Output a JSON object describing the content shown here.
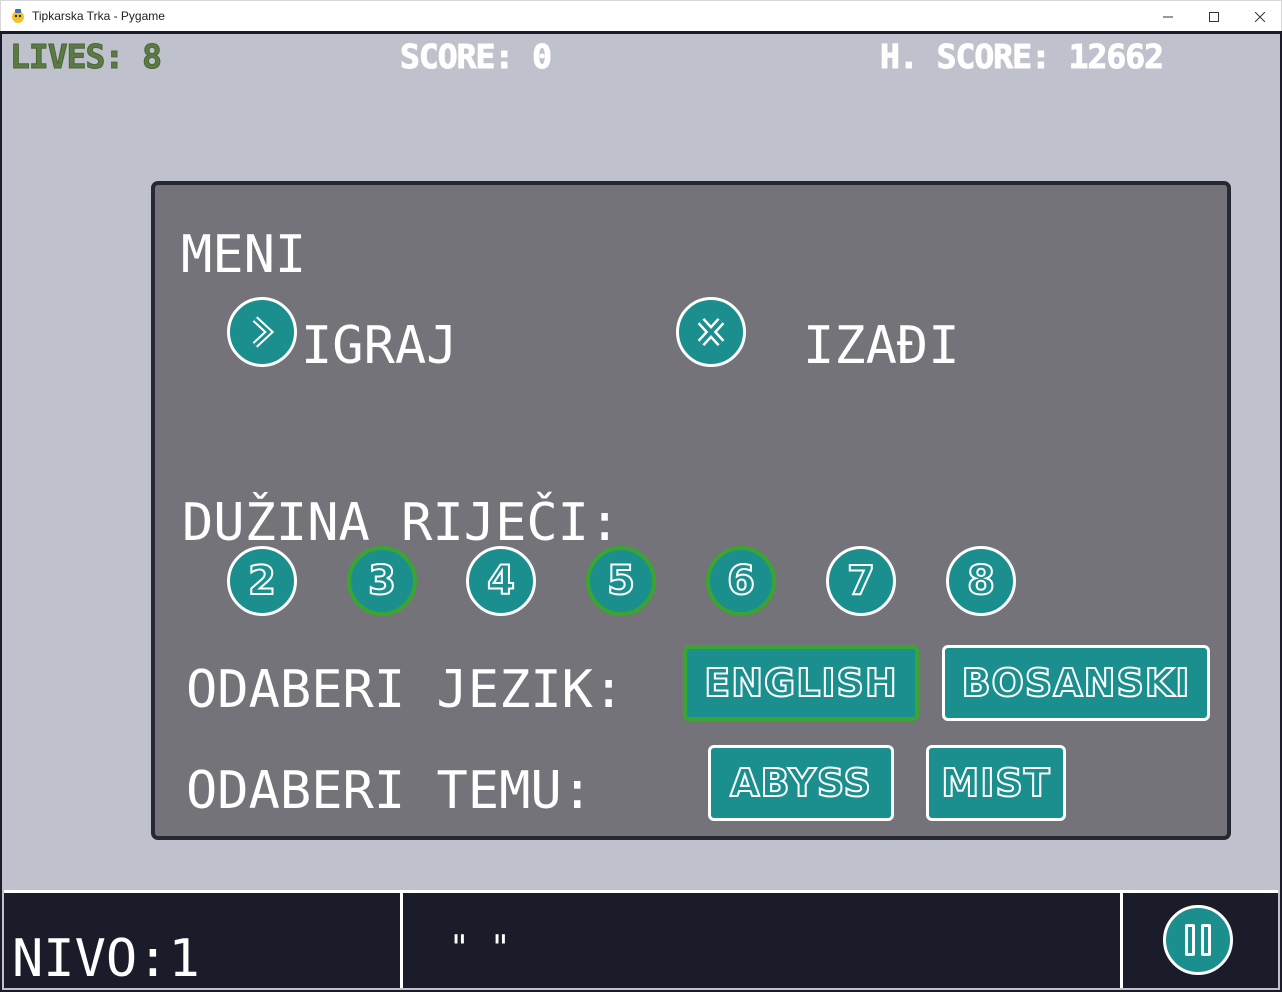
{
  "window": {
    "title": "Tipkarska Trka - Pygame",
    "controls": [
      "minimize-icon",
      "maximize-icon",
      "close-icon"
    ]
  },
  "hud": {
    "lives": "LIVES: 8",
    "score": "SCORE: 0",
    "high_score": "H. SCORE: 12662"
  },
  "menu": {
    "title": "MENI",
    "play_label": "IGRAJ",
    "play_icon": "chevron-right-icon",
    "exit_label": "IZAĐI",
    "exit_icon": "x-icon",
    "word_length_label": "DUŽINA RIJEČI:",
    "word_lengths": [
      {
        "value": "2",
        "selected": false
      },
      {
        "value": "3",
        "selected": true
      },
      {
        "value": "4",
        "selected": false
      },
      {
        "value": "5",
        "selected": true
      },
      {
        "value": "6",
        "selected": true
      },
      {
        "value": "7",
        "selected": false
      },
      {
        "value": "8",
        "selected": false
      }
    ],
    "language_label": "ODABERI JEZIK:",
    "languages": [
      {
        "label": "ENGLISH",
        "selected": true
      },
      {
        "label": "BOSANSKI",
        "selected": false
      }
    ],
    "theme_label": "ODABERI TEMU:",
    "themes": [
      {
        "label": "ABYSS",
        "selected": false
      },
      {
        "label": "MIST",
        "selected": false
      }
    ]
  },
  "bottom_bar": {
    "level": "NIVO:1",
    "typed_word": "\" \"",
    "pause_icon": "pause-icon"
  },
  "colors": {
    "background": "#bfc1cc",
    "panel": "#737379",
    "button": "#1b8e8e",
    "selected_border": "#3aa533",
    "lives_text": "#5b7a46",
    "bottom_bar": "#1b1c2a"
  }
}
